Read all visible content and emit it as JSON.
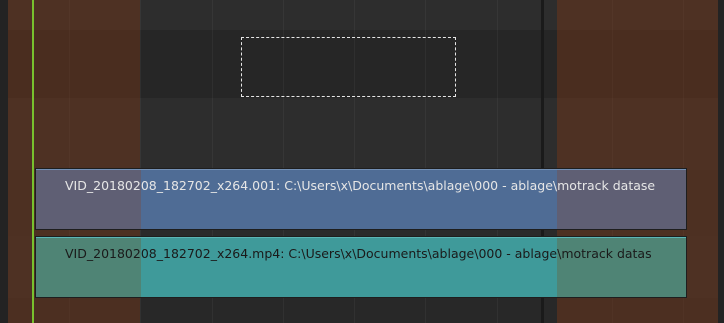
{
  "sequencer": {
    "strips": [
      {
        "type": "movie",
        "label": "VID_20180208_182702_x264.001: C:\\Users\\x\\Documents\\ablage\\000 - ablage\\motrack datase",
        "color": "#4f6c95"
      },
      {
        "type": "sound",
        "label": "VID_20180208_182702_x264.mp4: C:\\Users\\x\\Documents\\ablage\\000 - ablage\\motrack datas",
        "color": "#3f9a9a"
      }
    ],
    "playhead_color": "#78c12e",
    "out_of_range_color": "#78371a"
  }
}
